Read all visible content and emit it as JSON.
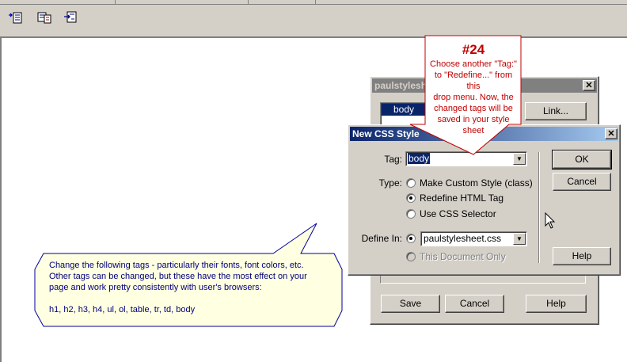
{
  "toolbar": {
    "icons": [
      "attach-stylesheet-icon",
      "edit-stylesheet-icon",
      "open-css-file-icon"
    ]
  },
  "callout": {
    "number": "#24",
    "lines": [
      "Choose another \"Tag:\"",
      "to \"Redefine...\" from this",
      "drop menu. Now, the",
      "changed tags will be",
      "saved in your style",
      "sheet"
    ]
  },
  "note": {
    "lines": [
      "Change the following  tags - particularly their fonts, font colors, etc.",
      "Other tags can be changed, but these have the most effect on your",
      "page and work pretty consistently with user's browsers:",
      "",
      "h1, h2, h3, h4, ul, ol, table, tr, td, body"
    ]
  },
  "back_dialog": {
    "title": "paulstylesh",
    "selected_item": "body",
    "link_button": "Link...",
    "save_button": "Save",
    "cancel_button": "Cancel",
    "help_button": "Help"
  },
  "front_dialog": {
    "title": "New CSS Style",
    "tag_label": "Tag:",
    "tag_value": "body",
    "type_label": "Type:",
    "type_options": [
      "Make Custom Style (class)",
      "Redefine HTML Tag",
      "Use CSS Selector"
    ],
    "type_selected": "Redefine HTML Tag",
    "define_in_label": "Define In:",
    "define_in_file": "paulstylesheet.css",
    "define_in_disabled": "This Document Only",
    "ok_button": "OK",
    "cancel_button": "Cancel",
    "help_button": "Help"
  },
  "colors": {
    "callout_text": "#c00000",
    "note_text": "#000080",
    "note_fill": "#ffffe1",
    "title_active": "#0a246a"
  }
}
